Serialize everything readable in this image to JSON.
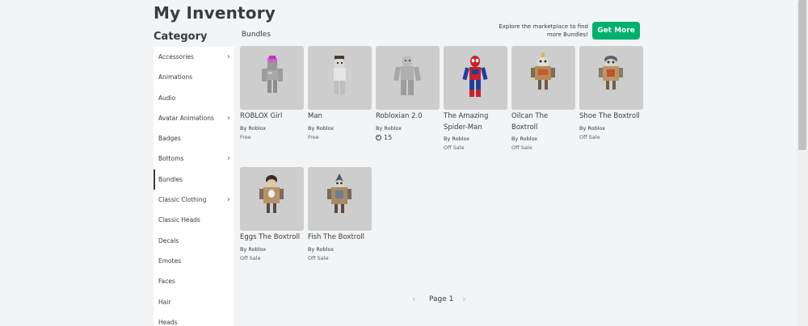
{
  "page_title": "My Inventory",
  "category_label": "Category",
  "section_label": "Bundles",
  "explore_text": "Explore the marketplace to find more Bundles!",
  "get_more_label": "Get More",
  "colors": {
    "accent": "#00b06f",
    "background": "#f2f4f5",
    "thumb_bg": "#cdcdcd"
  },
  "sidebar": {
    "items": [
      {
        "label": "Accessories",
        "chevron": true,
        "icon": "chevron-right-icon"
      },
      {
        "label": "Animations",
        "chevron": false
      },
      {
        "label": "Audio",
        "chevron": false
      },
      {
        "label": "Avatar Animations",
        "chevron": true,
        "icon": "chevron-right-icon"
      },
      {
        "label": "Badges",
        "chevron": false
      },
      {
        "label": "Bottoms",
        "chevron": true,
        "icon": "chevron-right-icon"
      },
      {
        "label": "Bundles",
        "chevron": false,
        "active": true
      },
      {
        "label": "Classic Clothing",
        "chevron": true,
        "icon": "chevron-right-icon"
      },
      {
        "label": "Classic Heads",
        "chevron": false
      },
      {
        "label": "Decals",
        "chevron": false
      },
      {
        "label": "Emotes",
        "chevron": false
      },
      {
        "label": "Faces",
        "chevron": false
      },
      {
        "label": "Hair",
        "chevron": false
      },
      {
        "label": "Heads",
        "chevron": false
      }
    ]
  },
  "bundles": [
    {
      "name": "ROBLOX Girl",
      "by": "By",
      "creator": "Roblox",
      "price": "Free"
    },
    {
      "name": "Man",
      "by": "By",
      "creator": "Roblox",
      "price": "Free"
    },
    {
      "name": "Robloxian 2.0",
      "by": "By",
      "creator": "Roblox",
      "price": "15",
      "price_icon": "robux-icon"
    },
    {
      "name": "The Amazing Spider-Man",
      "by": "By",
      "creator": "Roblox",
      "price": "Off Sale"
    },
    {
      "name": "Oilcan The Boxtroll",
      "by": "By",
      "creator": "Roblox",
      "price": "Off Sale"
    },
    {
      "name": "Shoe The Boxtroll",
      "by": "By",
      "creator": "Roblox",
      "price": "Off Sale"
    },
    {
      "name": "Eggs The Boxtroll",
      "by": "By",
      "creator": "Roblox",
      "price": "Off Sale"
    },
    {
      "name": "Fish The Boxtroll",
      "by": "By",
      "creator": "Roblox",
      "price": "Off Sale"
    }
  ],
  "pagination": {
    "label": "Page 1",
    "prev_icon": "chevron-left-icon",
    "next_icon": "chevron-right-icon"
  }
}
